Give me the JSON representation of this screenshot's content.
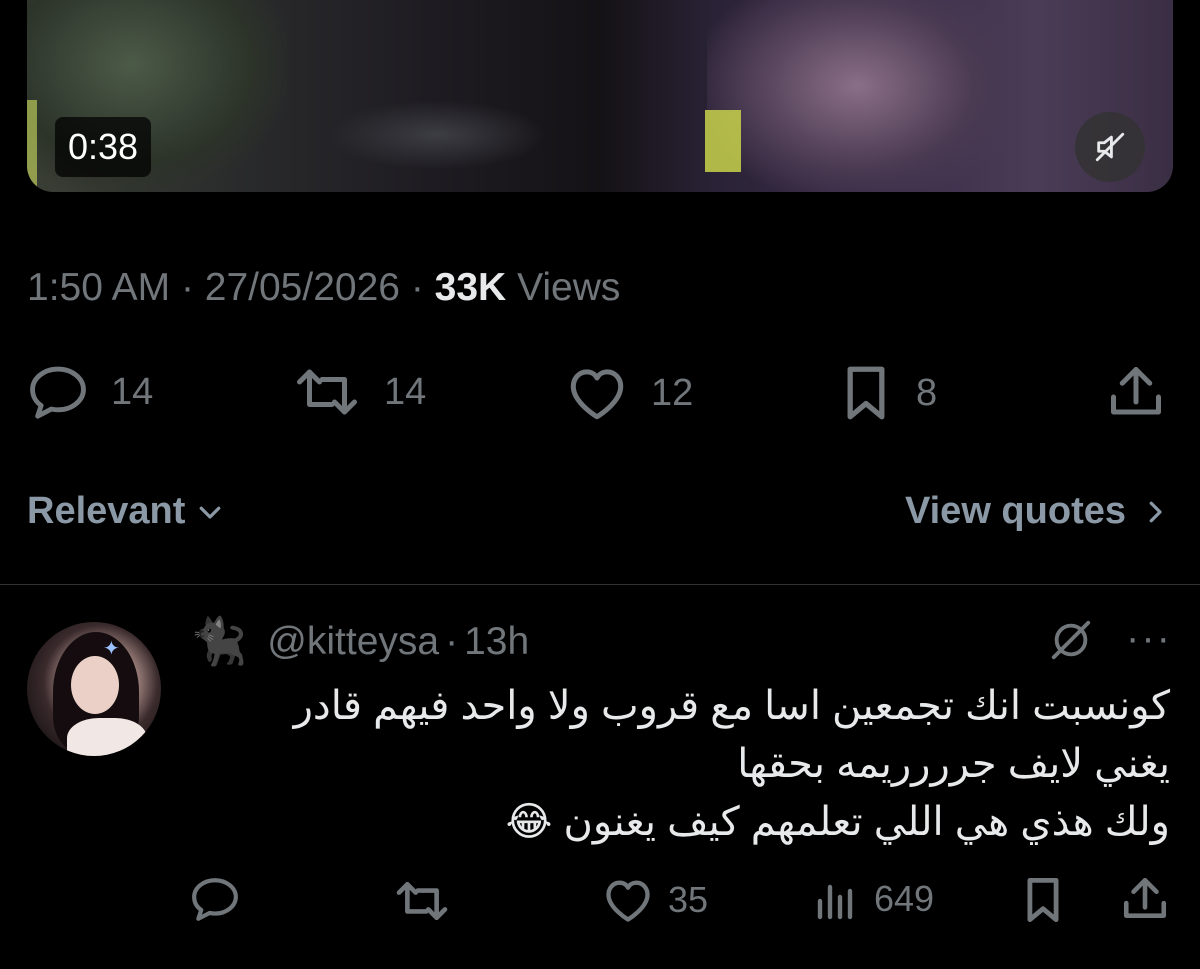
{
  "video": {
    "duration": "0:38",
    "mute_icon": "speaker-muted-icon"
  },
  "tweet": {
    "time": "1:50 AM",
    "sep1": "·",
    "date": "27/05/2026",
    "sep2": "·",
    "views_count": "33K",
    "views_label": "Views",
    "actions": {
      "replies": "14",
      "reposts": "14",
      "likes": "12",
      "bookmarks": "8"
    }
  },
  "sort": {
    "label": "Relevant",
    "view_quotes": "View quotes"
  },
  "reply": {
    "emoji": "🐈‍⬛",
    "handle": "@kitteysa",
    "sep": "·",
    "time": "13h",
    "more": "···",
    "lines": [
      "كونسبت انك تجمعين اسا مع قروب ولا واحد فيهم قادر",
      "يغني لايف جرررريمه بحقها",
      "ولك هذي هي اللي تعلمهم كيف يغنون 😂"
    ],
    "actions": {
      "likes": "35",
      "views": "649"
    }
  }
}
